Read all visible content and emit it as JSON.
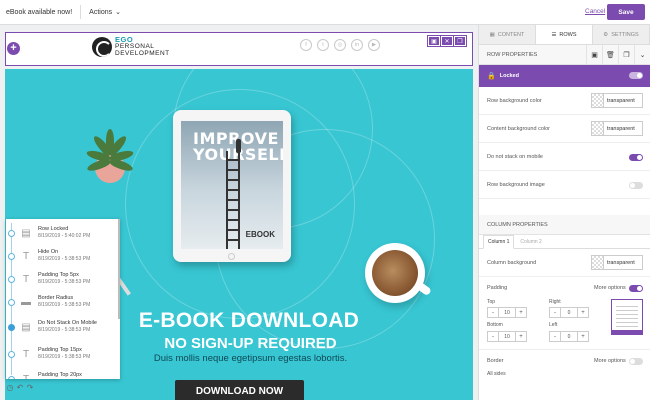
{
  "topbar": {
    "title": "eBook available now!",
    "actions_label": "Actions",
    "cancel_label": "Cancel",
    "save_label": "Save"
  },
  "header": {
    "logo_line1": "EGO",
    "logo_line2": "PERSONAL",
    "logo_line3": "DEVELOPMENT",
    "socials": [
      "facebook-icon",
      "twitter-icon",
      "instagram-icon",
      "linkedin-icon",
      "youtube-icon"
    ],
    "social_glyphs": [
      "f",
      "t",
      "◎",
      "in",
      "▶"
    ]
  },
  "hero": {
    "book_title_1": "IMPROVE",
    "book_title_2": "YOURSELF",
    "book_label": "EBOOK",
    "heading": "E-BOOK DOWNLOAD",
    "subheading": "NO SIGN-UP REQUIRED",
    "body": "Duis mollis neque egetipsum egestas lobortis.",
    "button": "DOWNLOAD NOW"
  },
  "history": [
    {
      "label": "Row Locked",
      "time": "8/19/2019 - 5:40:02 PM",
      "icon": "row-icon",
      "glyph": "▤",
      "active": false
    },
    {
      "label": "Hide On",
      "time": "8/19/2019 - 5:38:53 PM",
      "icon": "text-icon",
      "glyph": "T",
      "active": false
    },
    {
      "label": "Padding Top 5px",
      "time": "8/19/2019 - 5:38:53 PM",
      "icon": "text-icon",
      "glyph": "T",
      "active": false
    },
    {
      "label": "Border Radius",
      "time": "8/19/2019 - 5:38:53 PM",
      "icon": "button-icon",
      "glyph": "▬",
      "active": false
    },
    {
      "label": "Do Not Stack On Mobile",
      "time": "8/19/2019 - 5:38:53 PM",
      "icon": "row-icon",
      "glyph": "▤",
      "active": true
    },
    {
      "label": "Padding Top 15px",
      "time": "8/19/2019 - 5:38:53 PM",
      "icon": "text-icon",
      "glyph": "T",
      "active": false
    },
    {
      "label": "Padding Top 20px",
      "time": "",
      "icon": "text-icon",
      "glyph": "T",
      "active": false
    }
  ],
  "panel": {
    "tabs": [
      {
        "label": "CONTENT",
        "icon": "content-icon",
        "glyph": "▦",
        "active": false
      },
      {
        "label": "ROWS",
        "icon": "rows-icon",
        "glyph": "☰",
        "active": true
      },
      {
        "label": "SETTINGS",
        "icon": "settings-icon",
        "glyph": "⚙",
        "active": false
      }
    ],
    "row_properties_title": "ROW PROPERTIES",
    "locked_label": "Locked",
    "row_bg_label": "Row background color",
    "row_bg_value": "transparent",
    "content_bg_label": "Content background color",
    "content_bg_value": "transparent",
    "no_stack_label": "Do not stack on mobile",
    "row_bg_image_label": "Row background image",
    "column_properties_title": "COLUMN PROPERTIES",
    "column_tabs": [
      "Column 1",
      "Column 2"
    ],
    "column_bg_label": "Column background",
    "column_bg_value": "transparent",
    "padding_label": "Padding",
    "more_options_label": "More options",
    "top_label": "Top",
    "top_value": "10",
    "right_label": "Right",
    "right_value": "0",
    "bottom_label": "Bottom",
    "bottom_value": "10",
    "left_label": "Left",
    "left_value": "0",
    "border_label": "Border",
    "border_more_options_label": "More options",
    "all_sides_label": "All sides"
  },
  "colors": {
    "accent": "#7b4bb0",
    "hero_bg": "#37c6d2",
    "button_dark": "#2b2b2b"
  }
}
